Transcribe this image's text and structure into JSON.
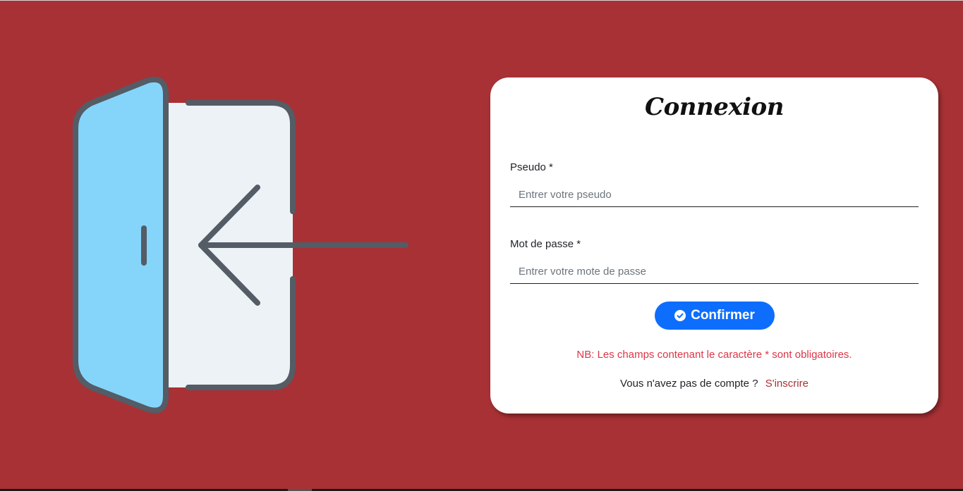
{
  "colors": {
    "background": "#a83135",
    "card": "#ffffff",
    "accent": "#0d6efd",
    "warning": "#dc3545",
    "door_panel": "#85d5fb",
    "door_frame_fill": "#edf2f6",
    "door_stroke": "#545c65"
  },
  "illustration": {
    "icon": "door-exit-arrow-icon"
  },
  "login_card": {
    "title": "Connexion",
    "pseudo": {
      "label": "Pseudo *",
      "placeholder": "Entrer votre pseudo",
      "value": ""
    },
    "password": {
      "label": "Mot de passe *",
      "placeholder": "Entrer votre mote de passe",
      "value": ""
    },
    "confirm_button": {
      "label": "Confirmer",
      "icon": "check-circle-icon"
    },
    "required_note": "NB: Les champs contenant le caractère * sont obligatoires.",
    "signup_prompt": "Vous n'avez pas de compte ?",
    "signup_link": "S'inscrire"
  }
}
